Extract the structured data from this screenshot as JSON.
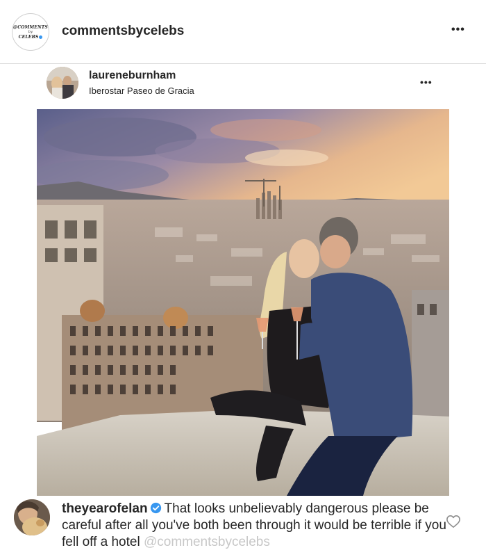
{
  "header": {
    "logo_line1": "@COMMENTS",
    "logo_line2": "by",
    "logo_line3": "CELEBS",
    "username": "commentsbycelebs",
    "more_icon": "ellipsis-icon"
  },
  "post": {
    "username": "laureneburnham",
    "location": "Iberostar Paseo de Gracia",
    "more_icon": "ellipsis-icon",
    "image_alt": "couple kissing on rooftop overlooking Barcelona and Sagrada Familia at sunset"
  },
  "comment": {
    "username": "theyearofelan",
    "verified_icon": "verified-badge-icon",
    "text": "That looks unbelievably dangerous please be careful after all you've both been through it would be terrible if you fell off a hotel",
    "watermark": "@commentsbycelebs",
    "like_icon": "heart-outline-icon"
  },
  "colors": {
    "verified": "#3897f0",
    "text": "#262626",
    "watermark": "#c7c7c7",
    "divider": "#dbdbdb"
  }
}
